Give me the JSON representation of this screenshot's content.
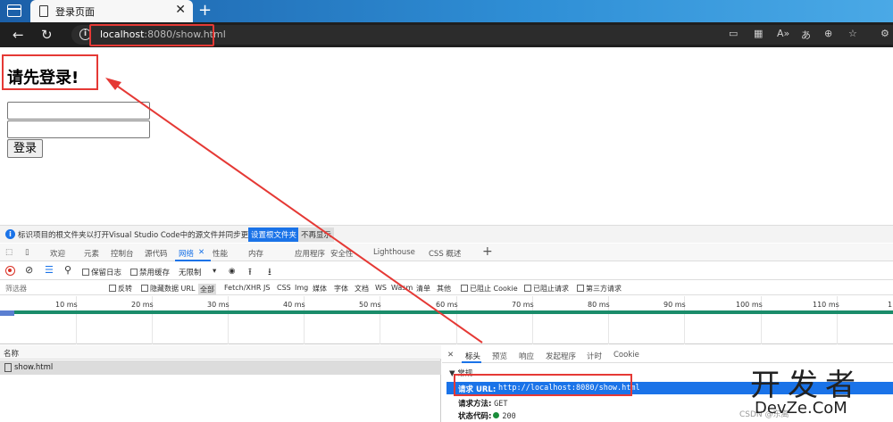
{
  "browser": {
    "tab_title": "登录页面",
    "tab_close": "✕",
    "new_tab": "+",
    "url_host": "localhost",
    "url_rest": ":8080/show.html",
    "info_glyph": "i"
  },
  "page": {
    "heading": "请先登录!",
    "login_button": "登录"
  },
  "devtools": {
    "notice_text": "标识项目的根文件夹以打开Visual Studio Code中的源文件并同步更改。",
    "notice_set_button": "设置根文件夹",
    "notice_dismiss": "不再显示",
    "tabs": [
      "欢迎",
      "元素",
      "控制台",
      "源代码",
      "网络",
      "性能",
      "内存",
      "应用程序",
      "安全性",
      "Lighthouse",
      "CSS 概述"
    ],
    "network_close": "✕",
    "toolbar": {
      "preserve_log": "保留日志",
      "disable_cache": "禁用缓存",
      "throttle": "无限制"
    },
    "filter": {
      "placeholder": "筛选器",
      "invert": "反转",
      "hide_data_url": "隐藏数据 URL",
      "types": [
        "全部",
        "Fetch/XHR",
        "JS",
        "CSS",
        "Img",
        "媒体",
        "字体",
        "文档",
        "WS",
        "Wasm",
        "清单",
        "其他"
      ],
      "blocked_cookies": "已阻止 Cookie",
      "blocked_requests": "已阻止请求",
      "third_party": "第三方请求"
    },
    "timeline_ticks": [
      "10 ms",
      "20 ms",
      "30 ms",
      "40 ms",
      "50 ms",
      "60 ms",
      "70 ms",
      "80 ms",
      "90 ms",
      "100 ms",
      "110 ms",
      "1"
    ],
    "list_header": "名称",
    "requests": [
      "show.html"
    ],
    "detail_tabs": [
      "标头",
      "预览",
      "响应",
      "发起程序",
      "计时",
      "Cookie"
    ],
    "detail_close": "✕",
    "section_title": "▼ 常规",
    "request_url_label": "请求 URL:",
    "request_url_value": "http://localhost:8080/show.html",
    "method_label": "请求方法:",
    "method_value": "GET",
    "status_label": "状态代码:",
    "status_value": "200"
  },
  "watermark": {
    "big": "开发者",
    "sub": "DevZe.CoM",
    "small": "CSDN @东离"
  },
  "colors": {
    "accent_blue": "#1a73e8",
    "highlight_red": "#e53935",
    "timeline_green": "#1a8c6a"
  }
}
